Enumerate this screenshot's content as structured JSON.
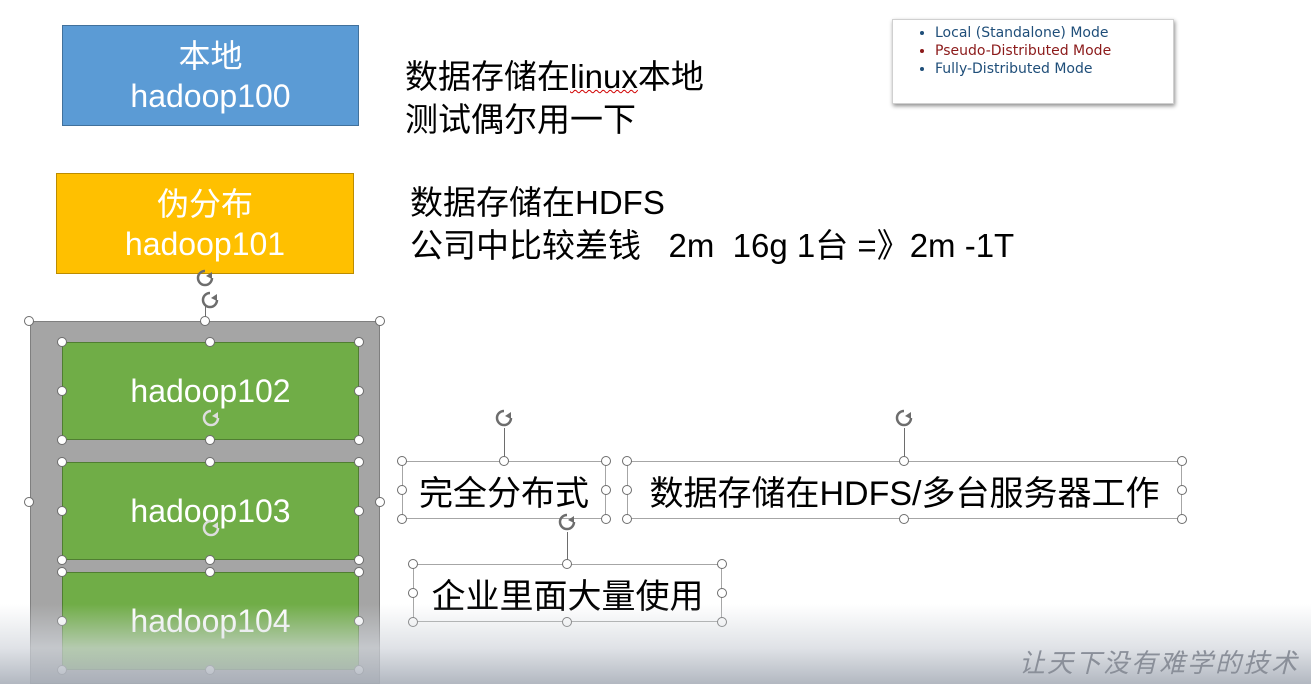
{
  "shapes": {
    "local": {
      "title": "本地",
      "host": "hadoop100"
    },
    "pseudo": {
      "title": "伪分布",
      "host": "hadoop101"
    },
    "cluster": [
      {
        "host": "hadoop102"
      },
      {
        "host": "hadoop103"
      },
      {
        "host": "hadoop104"
      }
    ]
  },
  "notes": {
    "local_line1_prefix": "数据存储在",
    "local_line1_word": "linux",
    "local_line1_suffix": "本地",
    "local_line2": "测试偶尔用一下",
    "pseudo_line1": "数据存储在HDFS",
    "pseudo_line2": "公司中比较差钱   2m  16g 1台 =》2m -1T"
  },
  "textboxes": {
    "fully": "完全分布式",
    "fully_desc": "数据存储在HDFS/多台服务器工作",
    "enterprise": "企业里面大量使用"
  },
  "legend": {
    "items": [
      "Local (Standalone) Mode",
      "Pseudo-Distributed Mode",
      "Fully-Distributed Mode"
    ]
  },
  "watermark": "让天下没有难学的技术",
  "colors": {
    "blue": "#5b9bd5",
    "orange": "#ffc000",
    "green": "#70ad47",
    "gray": "#a5a5a5"
  }
}
